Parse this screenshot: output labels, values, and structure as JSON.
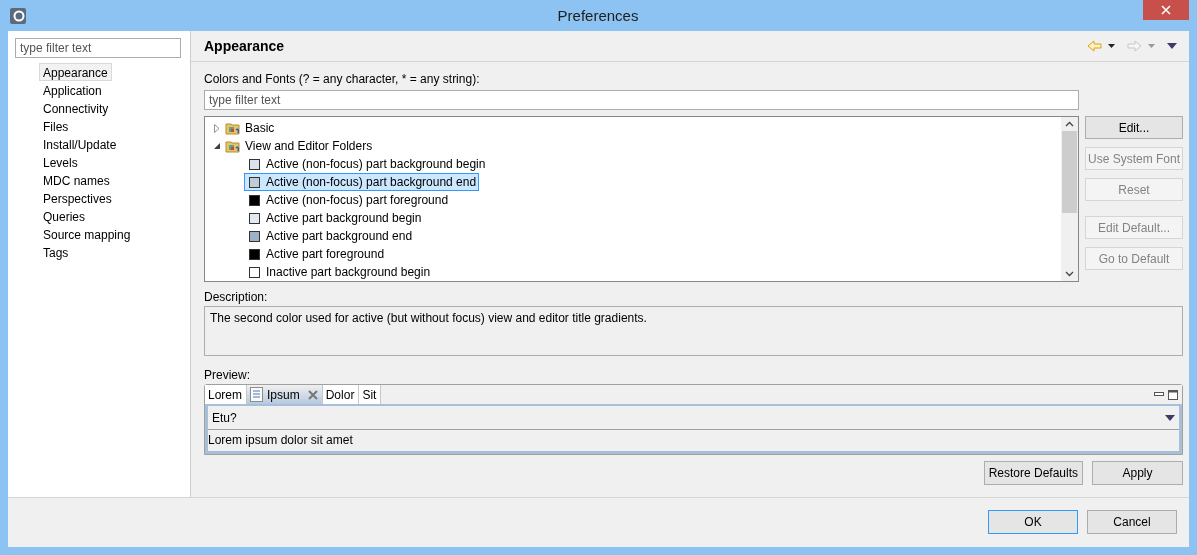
{
  "window": {
    "title": "Preferences"
  },
  "sidebar": {
    "filter": {
      "placeholder": "type filter text"
    },
    "items": [
      {
        "label": "Appearance",
        "selected": true
      },
      {
        "label": "Application",
        "selected": false
      },
      {
        "label": "Connectivity",
        "selected": false
      },
      {
        "label": "Files",
        "selected": false
      },
      {
        "label": "Install/Update",
        "selected": false
      },
      {
        "label": "Levels",
        "selected": false
      },
      {
        "label": "MDC names",
        "selected": false
      },
      {
        "label": "Perspectives",
        "selected": false
      },
      {
        "label": "Queries",
        "selected": false
      },
      {
        "label": "Source mapping",
        "selected": false
      },
      {
        "label": "Tags",
        "selected": false
      }
    ]
  },
  "page": {
    "title": "Appearance",
    "filter_label": "Colors and Fonts (? = any character, * = any string):",
    "filter": {
      "placeholder": "type filter text"
    },
    "tree": [
      {
        "label": "Basic",
        "expanded": false,
        "selected": false
      },
      {
        "label": "View and Editor Folders",
        "expanded": true,
        "selected": false,
        "children": [
          {
            "label": "Active (non-focus) part background begin",
            "color": "#dce3ec",
            "selected": false
          },
          {
            "label": "Active (non-focus) part background end",
            "color": "#c0cbd8",
            "selected": true
          },
          {
            "label": "Active (non-focus) part foreground",
            "color": "#000000",
            "selected": false
          },
          {
            "label": "Active part background begin",
            "color": "#e3e9f2",
            "selected": false
          },
          {
            "label": "Active part background end",
            "color": "#9cb0c8",
            "selected": false
          },
          {
            "label": "Active part foreground",
            "color": "#000000",
            "selected": false
          },
          {
            "label": "Inactive part background begin",
            "color": "#ffffff",
            "selected": false
          }
        ]
      }
    ],
    "side_buttons": [
      {
        "label": "Edit...",
        "disabled": false
      },
      {
        "label": "Use System Font",
        "disabled": true
      },
      {
        "label": "Reset",
        "disabled": true
      },
      {
        "label": "Edit Default...",
        "disabled": true
      },
      {
        "label": "Go to Default",
        "disabled": true
      }
    ],
    "description_label": "Description:",
    "description": "The second color used for active (but without focus) view and editor title gradients.",
    "preview_label": "Preview:",
    "preview": {
      "tabs": [
        {
          "label": "Lorem",
          "selected": false
        },
        {
          "label": "Ipsum",
          "selected": true
        },
        {
          "label": "Dolor",
          "selected": false
        },
        {
          "label": "Sit",
          "selected": false
        }
      ],
      "combo": "Etu?",
      "text": "Lorem ipsum dolor sit amet"
    },
    "buttons": [
      "Restore Defaults",
      "Apply"
    ]
  },
  "dialog_buttons": [
    {
      "label": "OK",
      "default": true
    },
    {
      "label": "Cancel",
      "default": false
    }
  ]
}
